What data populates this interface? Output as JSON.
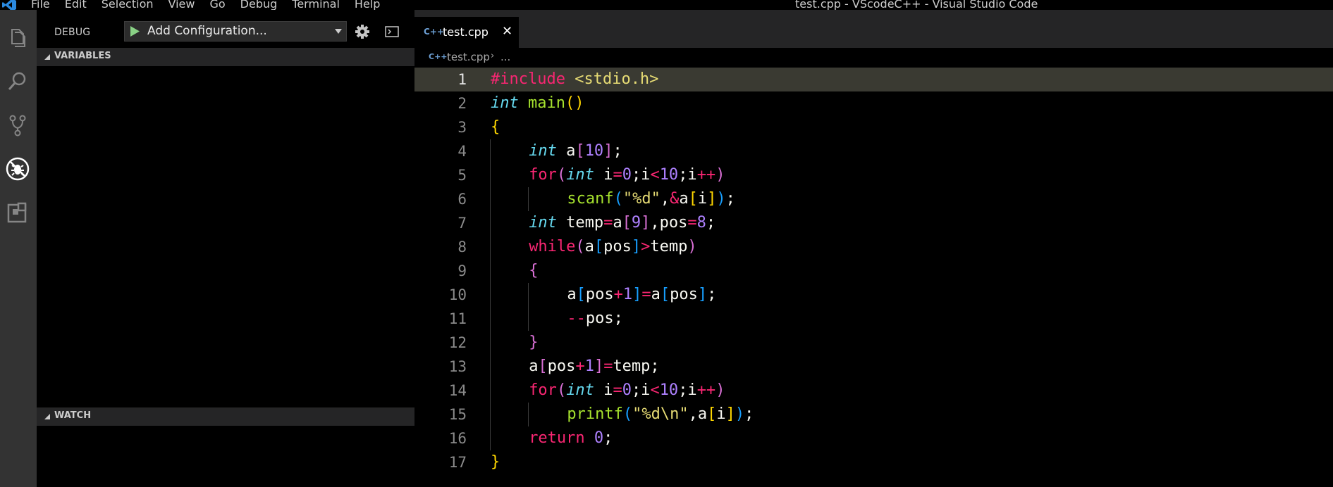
{
  "window": {
    "title": "test.cpp - VScodeC++ - Visual Studio Code",
    "menu": [
      "File",
      "Edit",
      "Selection",
      "View",
      "Go",
      "Debug",
      "Terminal",
      "Help"
    ]
  },
  "activity_bar": {
    "icons": [
      "files-icon",
      "search-icon",
      "source-control-icon",
      "debug-icon",
      "extensions-icon"
    ],
    "active": "debug-icon"
  },
  "sidebar": {
    "title": "DEBUG",
    "configuration": "Add Configuration...",
    "sections": [
      "VARIABLES",
      "WATCH"
    ]
  },
  "editor": {
    "tab": {
      "name": "test.cpp",
      "icon_text": "C++",
      "close_glyph": "✕"
    },
    "breadcrumb": {
      "file": "test.cpp",
      "separator": "›",
      "more": "..."
    },
    "current_line": 1,
    "lines": [
      {
        "n": "1",
        "indent": 0,
        "tokens": [
          [
            "pp",
            "#include"
          ],
          [
            "id",
            " "
          ],
          [
            "inc",
            "<stdio.h>"
          ]
        ]
      },
      {
        "n": "2",
        "indent": 0,
        "tokens": [
          [
            "type",
            "int"
          ],
          [
            "id",
            " "
          ],
          [
            "fn",
            "main"
          ],
          [
            "b1",
            "()"
          ]
        ]
      },
      {
        "n": "3",
        "indent": 0,
        "tokens": [
          [
            "b1",
            "{"
          ]
        ]
      },
      {
        "n": "4",
        "indent": 1,
        "tokens": [
          [
            "type",
            "int"
          ],
          [
            "id",
            " a"
          ],
          [
            "b2",
            "["
          ],
          [
            "num",
            "10"
          ],
          [
            "b2",
            "]"
          ],
          [
            "id",
            ";"
          ]
        ]
      },
      {
        "n": "5",
        "indent": 1,
        "tokens": [
          [
            "kw",
            "for"
          ],
          [
            "b2",
            "("
          ],
          [
            "type",
            "int"
          ],
          [
            "id",
            " i"
          ],
          [
            "op",
            "="
          ],
          [
            "num",
            "0"
          ],
          [
            "id",
            ";i"
          ],
          [
            "op",
            "<"
          ],
          [
            "num",
            "10"
          ],
          [
            "id",
            ";i"
          ],
          [
            "op",
            "++"
          ],
          [
            "b2",
            ")"
          ]
        ]
      },
      {
        "n": "6",
        "indent": 2,
        "tokens": [
          [
            "fn",
            "scanf"
          ],
          [
            "b3",
            "("
          ],
          [
            "str",
            "\"%d\""
          ],
          [
            "id",
            ","
          ],
          [
            "op",
            "&"
          ],
          [
            "id",
            "a"
          ],
          [
            "b1",
            "["
          ],
          [
            "id",
            "i"
          ],
          [
            "b1",
            "]"
          ],
          [
            "b3",
            ")"
          ],
          [
            "id",
            ";"
          ]
        ]
      },
      {
        "n": "7",
        "indent": 1,
        "tokens": [
          [
            "type",
            "int"
          ],
          [
            "id",
            " temp"
          ],
          [
            "op",
            "="
          ],
          [
            "id",
            "a"
          ],
          [
            "b2",
            "["
          ],
          [
            "num",
            "9"
          ],
          [
            "b2",
            "]"
          ],
          [
            "id",
            ",pos"
          ],
          [
            "op",
            "="
          ],
          [
            "num",
            "8"
          ],
          [
            "id",
            ";"
          ]
        ]
      },
      {
        "n": "8",
        "indent": 1,
        "tokens": [
          [
            "kw",
            "while"
          ],
          [
            "b2",
            "("
          ],
          [
            "id",
            "a"
          ],
          [
            "b3",
            "["
          ],
          [
            "id",
            "pos"
          ],
          [
            "b3",
            "]"
          ],
          [
            "op",
            ">"
          ],
          [
            "id",
            "temp"
          ],
          [
            "b2",
            ")"
          ]
        ]
      },
      {
        "n": "9",
        "indent": 1,
        "tokens": [
          [
            "b2",
            "{"
          ]
        ]
      },
      {
        "n": "10",
        "indent": 2,
        "tokens": [
          [
            "id",
            "a"
          ],
          [
            "b3",
            "["
          ],
          [
            "id",
            "pos"
          ],
          [
            "op",
            "+"
          ],
          [
            "num",
            "1"
          ],
          [
            "b3",
            "]"
          ],
          [
            "op",
            "="
          ],
          [
            "id",
            "a"
          ],
          [
            "b3",
            "["
          ],
          [
            "id",
            "pos"
          ],
          [
            "b3",
            "]"
          ],
          [
            "id",
            ";"
          ]
        ]
      },
      {
        "n": "11",
        "indent": 2,
        "tokens": [
          [
            "op",
            "--"
          ],
          [
            "id",
            "pos;"
          ]
        ]
      },
      {
        "n": "12",
        "indent": 1,
        "tokens": [
          [
            "b2",
            "}"
          ]
        ]
      },
      {
        "n": "13",
        "indent": 1,
        "tokens": [
          [
            "id",
            "a"
          ],
          [
            "b2",
            "["
          ],
          [
            "id",
            "pos"
          ],
          [
            "op",
            "+"
          ],
          [
            "num",
            "1"
          ],
          [
            "b2",
            "]"
          ],
          [
            "op",
            "="
          ],
          [
            "id",
            "temp;"
          ]
        ]
      },
      {
        "n": "14",
        "indent": 1,
        "tokens": [
          [
            "kw",
            "for"
          ],
          [
            "b2",
            "("
          ],
          [
            "type",
            "int"
          ],
          [
            "id",
            " i"
          ],
          [
            "op",
            "="
          ],
          [
            "num",
            "0"
          ],
          [
            "id",
            ";i"
          ],
          [
            "op",
            "<"
          ],
          [
            "num",
            "10"
          ],
          [
            "id",
            ";i"
          ],
          [
            "op",
            "++"
          ],
          [
            "b2",
            ")"
          ]
        ]
      },
      {
        "n": "15",
        "indent": 2,
        "tokens": [
          [
            "fn",
            "printf"
          ],
          [
            "b3",
            "("
          ],
          [
            "str",
            "\"%d\\n\""
          ],
          [
            "id",
            ",a"
          ],
          [
            "b1",
            "["
          ],
          [
            "id",
            "i"
          ],
          [
            "b1",
            "]"
          ],
          [
            "b3",
            ")"
          ],
          [
            "id",
            ";"
          ]
        ]
      },
      {
        "n": "16",
        "indent": 1,
        "tokens": [
          [
            "kw",
            "return"
          ],
          [
            "id",
            " "
          ],
          [
            "num",
            "0"
          ],
          [
            "id",
            ";"
          ]
        ]
      },
      {
        "n": "17",
        "indent": 0,
        "tokens": [
          [
            "b1",
            "}"
          ]
        ]
      }
    ]
  }
}
